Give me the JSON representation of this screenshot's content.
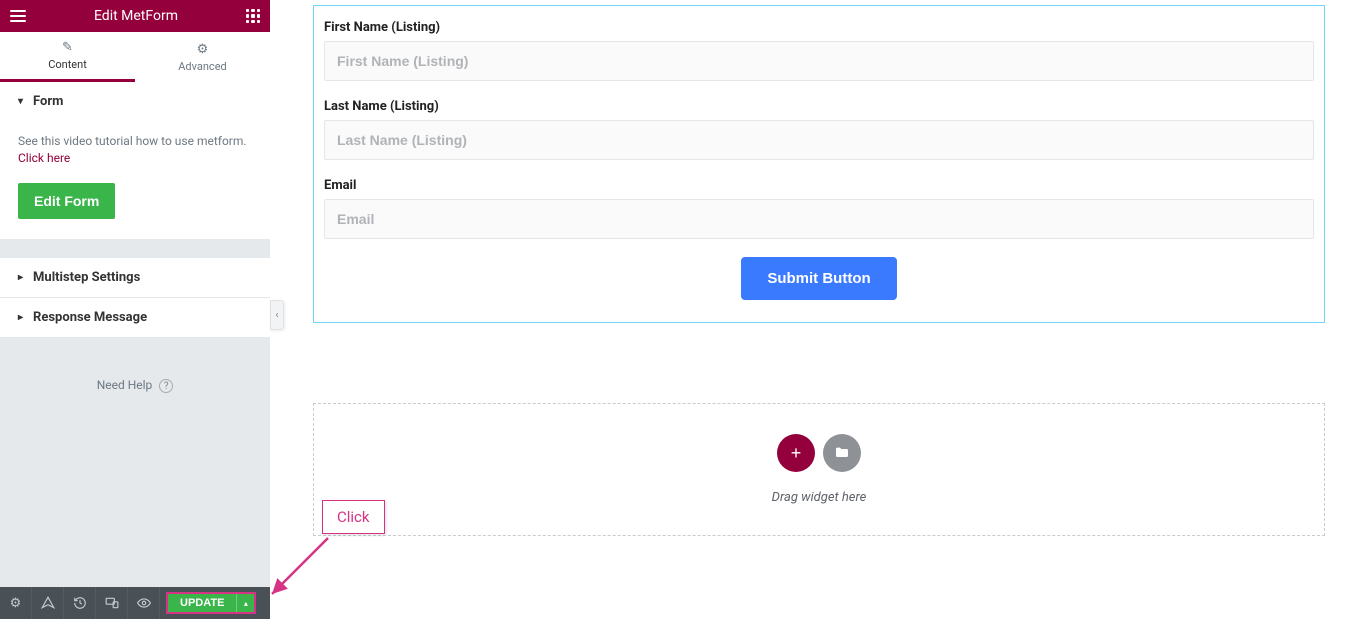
{
  "header": {
    "title": "Edit MetForm"
  },
  "tabs": {
    "content": "Content",
    "advanced": "Advanced"
  },
  "accordion": {
    "form": "Form",
    "multistep": "Multistep Settings",
    "response": "Response Message"
  },
  "form_panel": {
    "help_text": "See this video tutorial how to use metform.",
    "help_link": "Click here",
    "edit_btn": "Edit Form"
  },
  "need_help": "Need Help",
  "update_btn": "UPDATE",
  "form": {
    "first_name_label": "First Name (Listing)",
    "first_name_placeholder": "First Name (Listing)",
    "last_name_label": "Last Name (Listing)",
    "last_name_placeholder": "Last Name (Listing)",
    "email_label": "Email",
    "email_placeholder": "Email",
    "submit": "Submit Button"
  },
  "dropzone": {
    "text": "Drag widget here"
  },
  "callout": {
    "click": "Click"
  }
}
